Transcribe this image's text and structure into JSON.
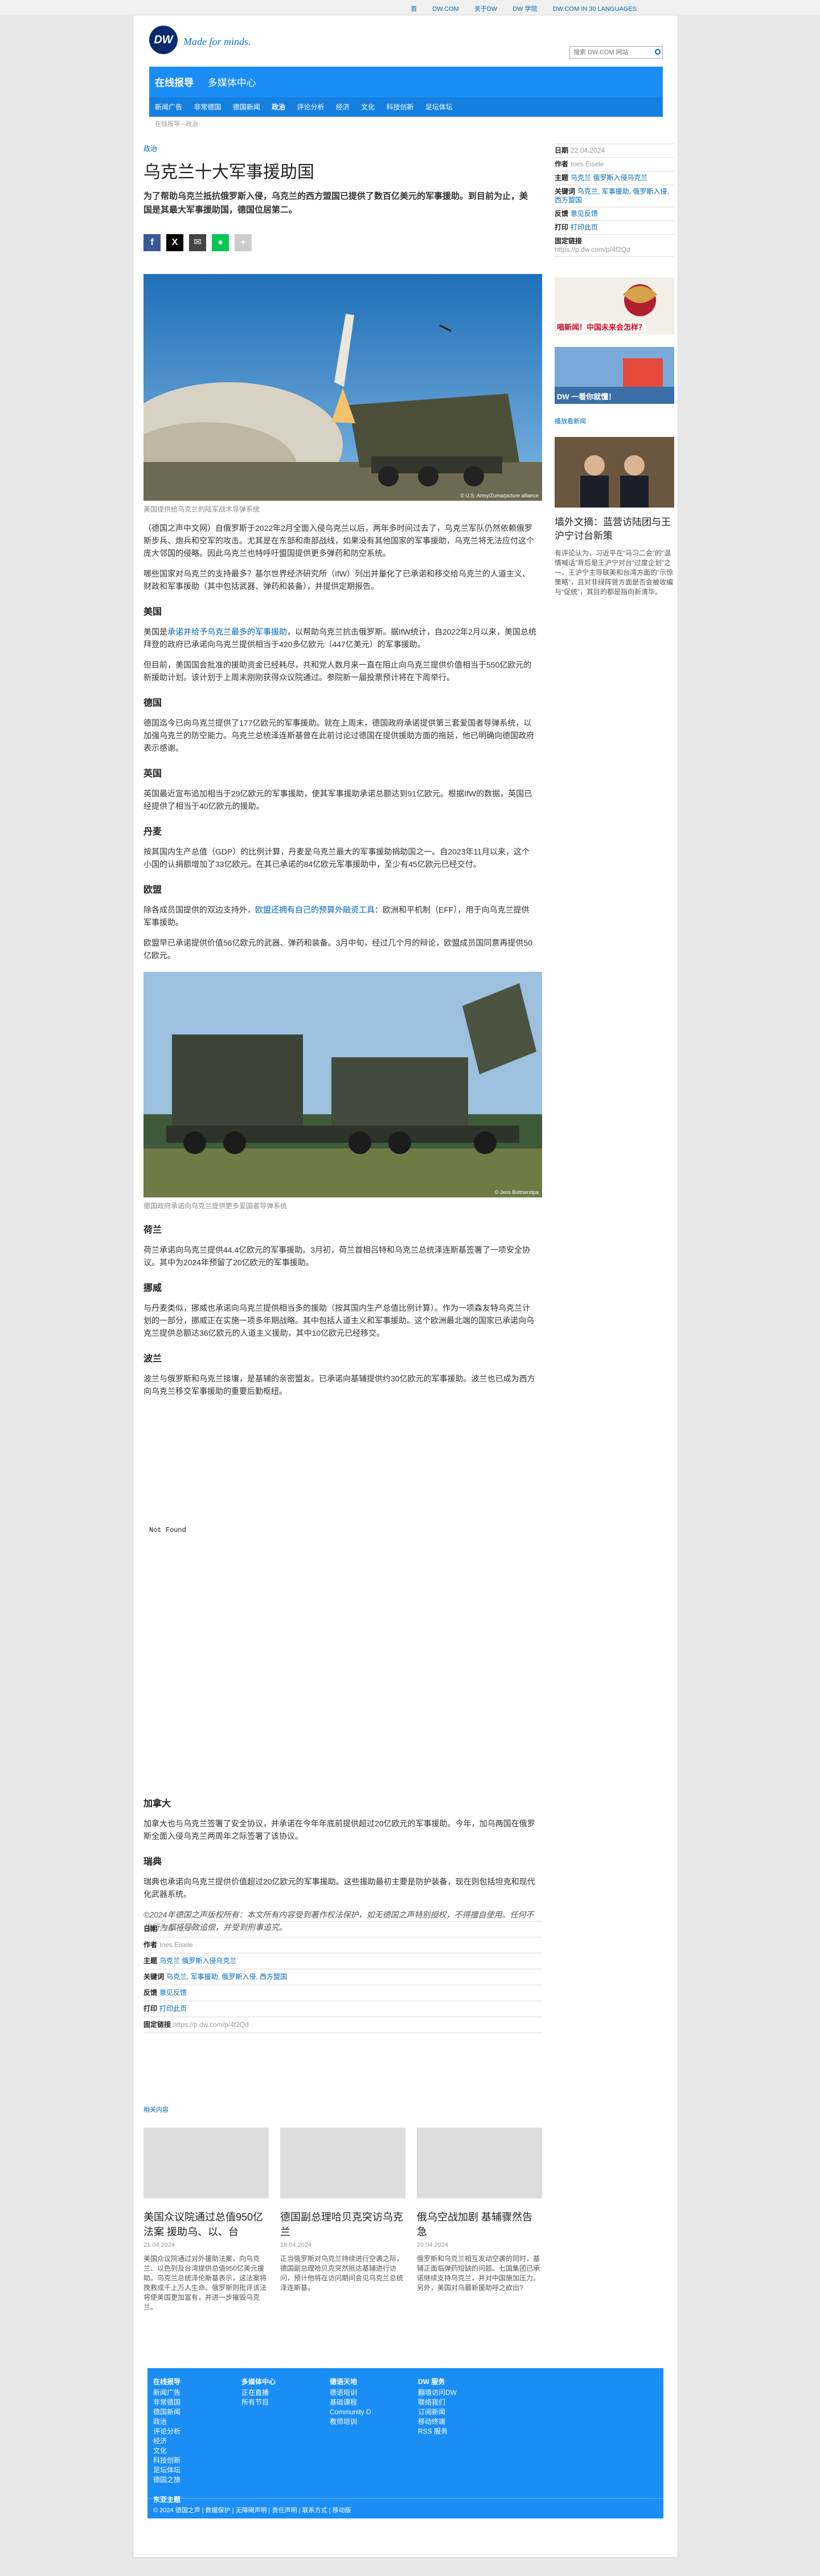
{
  "topbar": {
    "links": [
      "首",
      "DW.COM",
      "关于DW",
      "DW 学院",
      "DW.COM IN 30 LANGUAGES"
    ]
  },
  "header": {
    "logo": "DW",
    "tagline": "Made for minds.",
    "search_placeholder": "搜索 DW.COM 网站"
  },
  "nav": {
    "sections": [
      "在线报导",
      "多媒体中心"
    ],
    "subnav": [
      "新闻广告",
      "非常德国",
      "德国新闻",
      "政治",
      "评论分析",
      "经济",
      "文化",
      "科技创新",
      "足坛体坛"
    ],
    "active": "政治"
  },
  "breadcrumb": "在线报导 › 政治",
  "article": {
    "kicker": "政治",
    "title": "乌克兰十大军事援助国",
    "lead": "为了帮助乌克兰抵抗俄罗斯入侵，乌克兰的西方盟国已提供了数百亿美元的军事援助。到目前为止，美国是其最大军事援助国，德国位居第二。",
    "photo1_caption": "美国提供给乌克兰的陆军战术导弹系统",
    "photo1_credit": "© U.S. Army/Zuma/picture alliance",
    "p1": "（德国之声中文网）自俄罗斯于2022年2月全面入侵乌克兰以后，两年多时间过去了，乌克兰军队仍然依赖俄罗斯步兵、炮兵和空军的攻击。尤其是在东部和南部战线，如果没有其他国家的军事援助，乌克兰将无法应付这个庞大邻国的侵略。因此乌克兰也特呼吁盟国提供更多弹药和防空系统。",
    "p2": "哪些国家对乌克兰的支持最多？基尔世界经济研究所（IfW）列出并量化了已承诺和移交给乌克兰的人道主义、财政和军事援助（其中包括武器、弹药和装备），并提供定期报告。",
    "h_us": "美国",
    "p3_pre": "美国是",
    "p3_link": "承诺并给予乌克兰最多的军事援助",
    "p3_post": "，以帮助乌克兰抗击俄罗斯。据IfW统计，自2022年2月以来，美国总统拜登的政府已承诺向乌克兰提供相当于420多亿欧元（447亿美元）的军事援助。",
    "p4": "但目前，美国国会批准的援助资金已经耗尽，共和党人数月来一直在阻止向乌克兰提供价值相当于550亿欧元的新援助计划。该计划于上周末刚刚获得众议院通过。参院新一届投票预计将在下周举行。",
    "h_de": "德国",
    "p5": "德国迄今已向乌克兰提供了177亿欧元的军事援助。就在上周末，德国政府承诺提供第三套爱国者导弹系统，以加强乌克兰的防空能力。乌克兰总统泽连斯基曾在此前讨论过德国在提供援助方面的拖延，他已明确向德国政府表示感谢。",
    "h_uk": "英国",
    "p6": "英国最近宣布追加相当于29亿欧元的军事援助，使其军事援助承诺总额达到91亿欧元。根据IfW的数据，英国已经提供了相当于40亿欧元的援助。",
    "h_dk": "丹麦",
    "p7": "按其国内生产总值（GDP）的比例计算，丹麦是乌克兰最大的军事援助捐助国之一。自2023年11月以来，这个小国的认捐额增加了33亿欧元。在其已承诺的84亿欧元军事援助中，至少有45亿欧元已经交付。",
    "h_eu": "欧盟",
    "p8_pre": "除各成员国提供的双边支持外，",
    "p8_link": "欧盟还拥有自己的预算外融资工具",
    "p8_post": "：欧洲和平机制（EFF），用于向乌克兰提供军事援助。",
    "p9": "欧盟早已承诺提供价值56亿欧元的武器、弹药和装备。3月中旬，经过几个月的辩论，欧盟成员国同意再提供50亿欧元。",
    "photo2_caption": "德国政府承诺向乌克兰提供更多爱国者导弹系统",
    "photo2_credit": "© Jens Büttner/dpa",
    "h_nl": "荷兰",
    "p10": "荷兰承诺向乌克兰提供44.4亿欧元的军事援助。3月初，荷兰首相吕特和乌克兰总统泽连斯基签署了一项安全协议。其中为2024年预留了20亿欧元的军事援助。",
    "h_no": "挪威",
    "p11": "与丹麦类似，挪威也承诺向乌克兰提供相当多的援助（按其国内生产总值比例计算）。作为一项森友特乌克兰计划的一部分，挪威正在实施一项多年期战略。其中包括人道主义和军事援助。这个欧洲最北端的国家已承诺向乌克兰提供总额达36亿欧元的人道主义援助，其中10亿欧元已经移交。",
    "h_pl": "波兰",
    "p12": "波兰与俄罗斯和乌克兰接壤，是基辅的亲密盟友。已承诺向基辅提供约30亿欧元的军事援助。波兰也已成为西方向乌克兰移交军事援助的重要后勤枢纽。",
    "embed": "Not Found",
    "h_ca": "加拿大",
    "p13": "加拿大也与乌克兰签署了安全协议，并承诺在今年年底前提供超过20亿欧元的军事援助。今年，加乌两国在俄罗斯全面入侵乌克兰两周年之际签署了该协议。",
    "h_se": "瑞典",
    "p14": "瑞典也承诺向乌克兰提供价值超过20亿欧元的军事援助。这些援助最初主要是防护装备，现在则包括坦克和现代化武器系统。",
    "copyright": "©2024年德国之声版权所有：本文所有内容受到著作权法保护，如无德国之声特别授权，不得擅自使用。任何不当行为都将导致追偿，并受到刑事追究。"
  },
  "meta": {
    "date_label": "日期",
    "date": "22.04.2024",
    "author_label": "作者",
    "author": "Ines Eisele",
    "topic_label": "主题",
    "topic": "乌克兰 俄罗斯入侵乌克兰",
    "keywords_label": "关键词",
    "keywords": "乌克兰, 军事援助, 俄罗斯入侵, 西方盟国",
    "feedback_label": "反馈",
    "feedback": "意见反馈",
    "print_label": "打印",
    "print": "打印此页",
    "link_label": "固定链接",
    "link": "https://p.dw.com/p/4f2Qd"
  },
  "sidebar": {
    "promo1": "唱新闻！中国未来会怎样？",
    "promo2": "DW 一看你就懂！",
    "related_label": "播放看新闻",
    "story_title": "墙外文摘：蓝营访陆团与王沪宁讨台新策",
    "story_desc": "有评论认为，习近平在“马习二会”的“温情喊话”背后是王沪宁对台“过度企划”之一。王沪宁主导联美和台湾方面的“示惊策略”，且对非绿阵营方面是否会被收编与“促统”，其目的都是指向新清华。"
  },
  "related": {
    "label": "相关内容",
    "items": [
      {
        "title": "美国众议院通过总值950亿法案 援助乌、以、台",
        "date": "21.04.2024",
        "desc": "美国众议院通过对外援助法案，向乌克兰、以色列及台湾提供总值950亿美元援助。乌克兰总统泽伦斯基表示，这法案将挽救成千上万人生命。俄罗斯则批评该法将使美国更加富有，并进一步摧毁乌克兰。"
      },
      {
        "title": "德国副总理哈贝克突访乌克兰",
        "date": "18.04.2024",
        "desc": "正当俄罗斯对乌克兰持续进行空袭之际，德国副总理哈贝克突然抵达基辅进行访问，预计他将在访问期间会见乌克兰总统泽连斯基。"
      },
      {
        "title": "俄乌空战加剧 基辅骤然告急",
        "date": "20.04.2024",
        "desc": "俄罗斯和乌克兰相互发动空袭的同时，基辅正面临弹药短缺的问题。七国集团已承诺继续支持乌克兰，并对中国施加压力。另外，美国对乌最新援助呼之欲出?"
      }
    ]
  },
  "footer": {
    "cols": [
      {
        "head": "在线报导",
        "items": [
          "新闻广告",
          "非常德国",
          "德国新闻",
          "政治",
          "评论分析",
          "经济",
          "文化",
          "科技创新",
          "足坛体坛",
          "德国之旅"
        ]
      },
      {
        "head": "多媒体中心",
        "items": [
          "正在直播",
          "所有节目"
        ]
      },
      {
        "head": "德语天地",
        "items": [
          "德语培训",
          "基础课程",
          "Community D",
          "教师培训"
        ]
      },
      {
        "head": "DW 服务",
        "items": [
          "翻墙访问DW",
          "联络我们",
          "订阅新闻",
          "移动终端",
          "RSS 服务"
        ]
      }
    ],
    "extra": "东亚主题",
    "bottom": "© 2024 德国之声 | 数据保护 | 无障碍声明 | 责任声明 | 联系方式 | 移动版"
  }
}
